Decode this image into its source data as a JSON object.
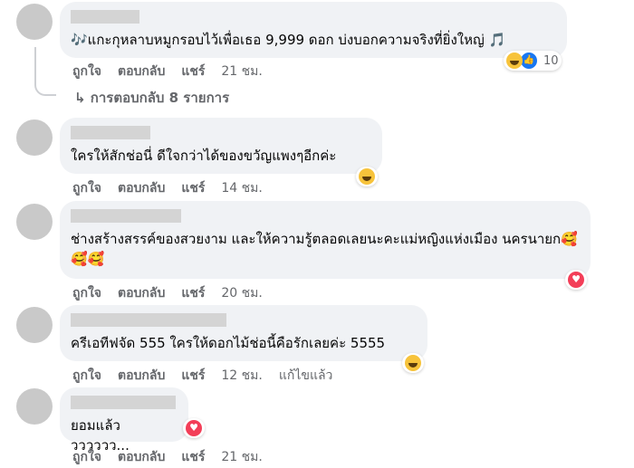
{
  "comments": [
    {
      "text": "🎶แกะกุหลาบหมูกรอบไว้เพื่อเธอ 9,999 ดอก บ่งบอกความจริงที่ยิ่งใหญ่ 🎵",
      "like_label": "ถูกใจ",
      "reply_label": "ตอบกลับ",
      "share_label": "แชร์",
      "time": "21 ชม.",
      "reaction_count": "10",
      "replies_label": "↳ การตอบกลับ 8 รายการ"
    },
    {
      "text": "ใครให้สักช่อนี่ ดีใจกว่าได้ของขวัญแพงๆอีกค่ะ",
      "like_label": "ถูกใจ",
      "reply_label": "ตอบกลับ",
      "share_label": "แชร์",
      "time": "14 ชม."
    },
    {
      "text": "ช่างสร้างสรรค์ของสวยงาม และให้ความรู้ตลอดเลยนะคะแม่หญิงแห่งเมือง นครนายก🥰🥰🥰",
      "like_label": "ถูกใจ",
      "reply_label": "ตอบกลับ",
      "share_label": "แชร์",
      "time": "20 ชม."
    },
    {
      "text": "ครีเอทีฟจัด 555 ใครให้ดอกไม้ช่อนี้คือรักเลยค่ะ 5555",
      "like_label": "ถูกใจ",
      "reply_label": "ตอบกลับ",
      "share_label": "แชร์",
      "time": "12 ชม.",
      "edited_label": "แก้ไขแล้ว"
    },
    {
      "text": "ยอมแล้ววววววว...",
      "like_label": "ถูกใจ",
      "reply_label": "ตอบกลับ",
      "share_label": "แชร์",
      "time": "21 ชม."
    }
  ],
  "colors": {
    "bubble": "#f0f2f5",
    "meta": "#65676b",
    "like": "#1877f2",
    "love": "#f33e58",
    "haha": "#f7c33b"
  }
}
